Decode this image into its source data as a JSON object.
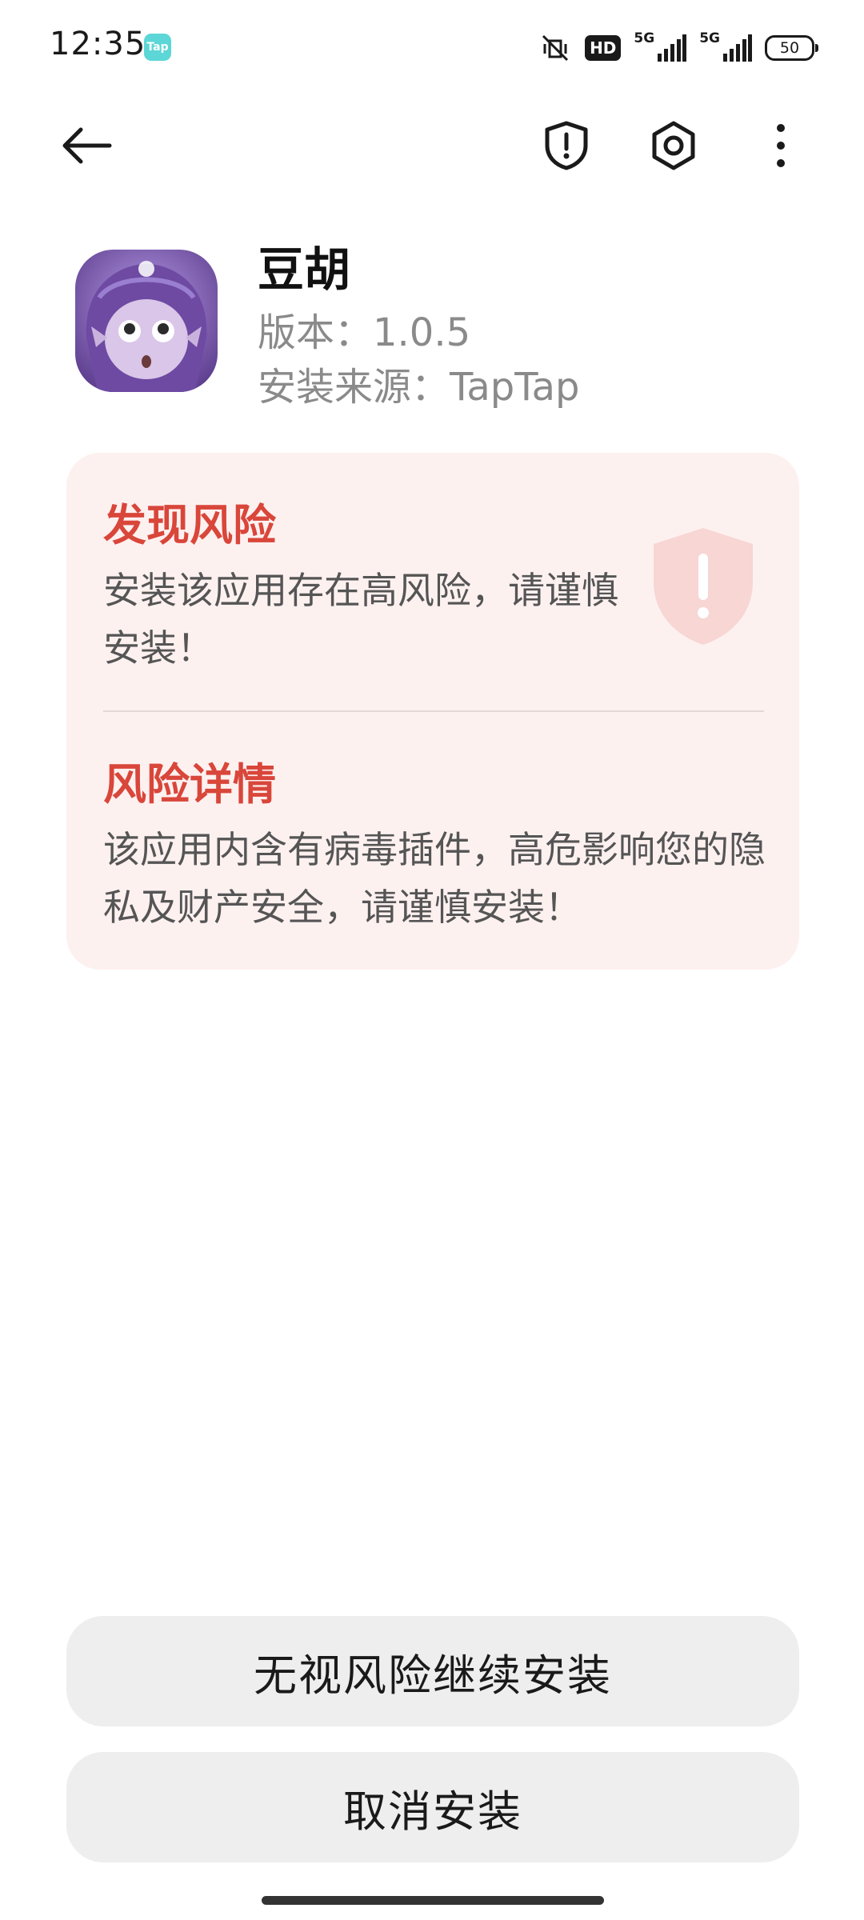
{
  "status_bar": {
    "time": "12:35",
    "notification_app_badge": "Tap",
    "hd_label": "HD",
    "signal1_label": "5G",
    "signal2_label": "5G",
    "battery_level": "50"
  },
  "toolbar": {
    "back_icon": "arrow-left-icon",
    "shield_icon": "shield-alert-icon",
    "settings_icon": "settings-hexagon-icon",
    "more_icon": "more-vertical-icon"
  },
  "app": {
    "name": "豆胡",
    "version_line": "版本：1.0.5",
    "source_line": "安装来源：TapTap"
  },
  "risk_card": {
    "title_found": "发现风险",
    "found_text": "安装该应用存在高风险，请谨慎安装！",
    "title_details": "风险详情",
    "details_text": "该应用内含有病毒插件，高危影响您的隐私及财产安全，请谨慎安装！",
    "accent_color": "#d9463a",
    "background_color": "#fdf1f0"
  },
  "actions": {
    "continue_label": "无视风险继续安装",
    "cancel_label": "取消安装"
  }
}
